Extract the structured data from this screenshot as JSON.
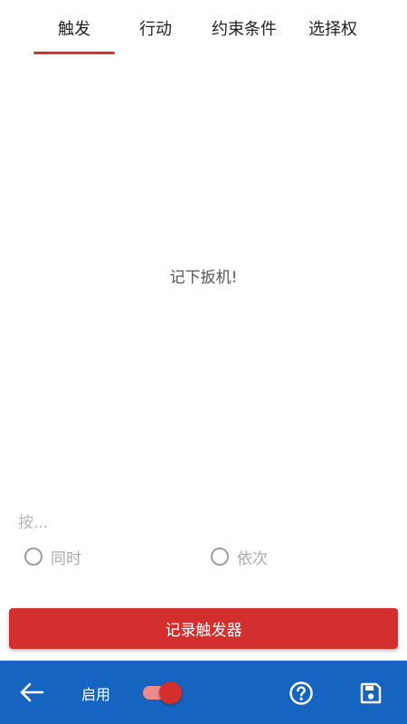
{
  "tabs": [
    {
      "label": "触发",
      "active": true
    },
    {
      "label": "行动",
      "active": false
    },
    {
      "label": "约束条件",
      "active": false
    },
    {
      "label": "选择权",
      "active": false
    }
  ],
  "main": {
    "message": "记下扳机!",
    "press_label": "按...",
    "radio_options": [
      {
        "label": "同时",
        "selected": false
      },
      {
        "label": "依次",
        "selected": false
      }
    ],
    "record_button": "记录触发器"
  },
  "bottom_bar": {
    "enable_label": "启用",
    "enabled": true,
    "icons": {
      "back": "arrow-left-icon",
      "help": "help-circle-icon",
      "save": "save-icon"
    }
  },
  "colors": {
    "accent": "#d32f2f",
    "bottom_bar": "#1565c0",
    "switch_track": "#ef8a8a"
  }
}
